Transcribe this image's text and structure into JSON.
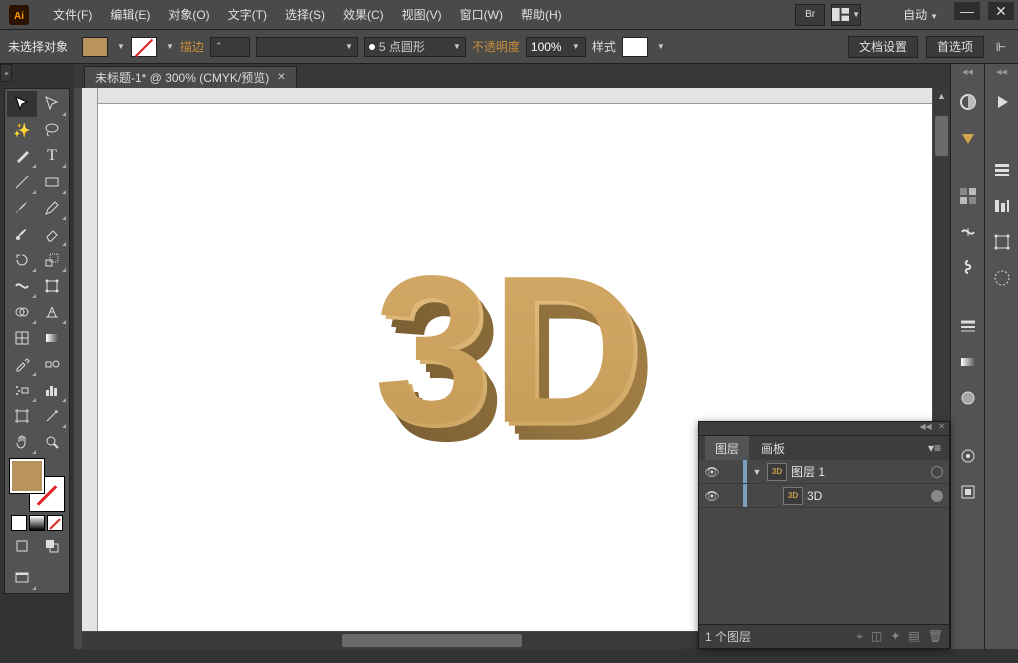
{
  "app": {
    "logo_text": "Ai"
  },
  "menu": {
    "file": "文件(F)",
    "edit": "编辑(E)",
    "object": "对象(O)",
    "type": "文字(T)",
    "select": "选择(S)",
    "effect": "效果(C)",
    "view": "视图(V)",
    "window": "窗口(W)",
    "help": "帮助(H)",
    "workspace_auto": "自动"
  },
  "control": {
    "no_selection": "未选择对象",
    "stroke_label": "描边",
    "stroke_weight": "",
    "brush_label": "5 点圆形",
    "opacity_label": "不透明度",
    "opacity_value": "100%",
    "style_label": "样式",
    "doc_setup": "文档设置",
    "preferences": "首选项"
  },
  "document": {
    "tab_title": "未标题-1* @ 300% (CMYK/预览)"
  },
  "colors": {
    "fill": "#b8935c",
    "stroke": "none"
  },
  "artwork": {
    "text": "3D"
  },
  "layers_panel": {
    "tab_layers": "图层",
    "tab_artboards": "画板",
    "rows": [
      {
        "thumb": "3D",
        "name": "图层 1",
        "expanded": true,
        "level": 0
      },
      {
        "thumb": "3D",
        "name": "3D",
        "level": 1
      }
    ],
    "footer": "1 个图层"
  }
}
